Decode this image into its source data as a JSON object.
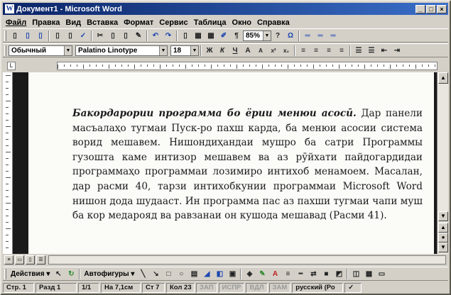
{
  "window": {
    "title": "Документ1 - Microsoft Word",
    "buttons": [
      "_",
      "□",
      "×"
    ]
  },
  "menu": [
    "Файл",
    "Правка",
    "Вид",
    "Вставка",
    "Формат",
    "Сервис",
    "Таблица",
    "Окно",
    "Справка"
  ],
  "toolbar_standard": {
    "icons": [
      "new-icon",
      "open-icon",
      "save-icon",
      "print-icon",
      "print-preview-icon",
      "spelling-icon",
      "cut-icon",
      "copy-icon",
      "paste-icon",
      "format-painter-icon",
      "undo-icon",
      "redo-icon",
      "hyperlink-icon",
      "tables-icon",
      "insert-table-icon",
      "drawing-icon",
      "show-hide-icon"
    ],
    "zoom": "85%",
    "glyphs": [
      "▯",
      "▯",
      "▯",
      "▯",
      "▯",
      "✓",
      "✂",
      "▯",
      "▯",
      "✎",
      "↶",
      "↷",
      "▯",
      "▦",
      "▦",
      "✐",
      "¶"
    ]
  },
  "toolbar_formatting": {
    "style": "Обычный",
    "font": "Palatino Linotype",
    "size": "18",
    "glyphs": [
      "Ж",
      "К",
      "Ч",
      "A",
      "A",
      "x²",
      "x₂",
      "≡",
      "≡",
      "≡",
      "≡",
      "☰",
      "☰",
      "⇤",
      "⇥"
    ]
  },
  "document": {
    "lead": "Бакордарории программа бо ёрии менюи асосӣ.",
    "body": " Дар панели масъалаҳо тугмаи Пуск-ро пахш карда, ба менюи асосии система ворид мешавем. Нишондиҳандаи мушро ба сатри Программы гузошта каме интизор мешавем ва аз рӯйхати пайдогардидаи программаҳо программаи лозимиро интихоб менамоем. Масалан, дар расми 40, тарзи интихобкунии программаи Microsoft Word нишон дода шудааст. Ин программа пас аз пахши тугмаи чапи муш ба кор медарояд ва равзанаи он кушода мешавад (Расми 41)."
  },
  "drawing_toolbar": {
    "actions_label": "Действия",
    "autoshapes_label": "Автофигуры"
  },
  "status": {
    "page": "Стр. 1",
    "section": "Разд 1",
    "pages": "1/1",
    "position": "На 7,1см",
    "line": "Ст 7",
    "column": "Кол 23",
    "rec": "ЗАП",
    "trk": "ИСПР",
    "ext": "ВДЛ",
    "ovr": "ЗАМ",
    "language": "русский (Ро"
  }
}
